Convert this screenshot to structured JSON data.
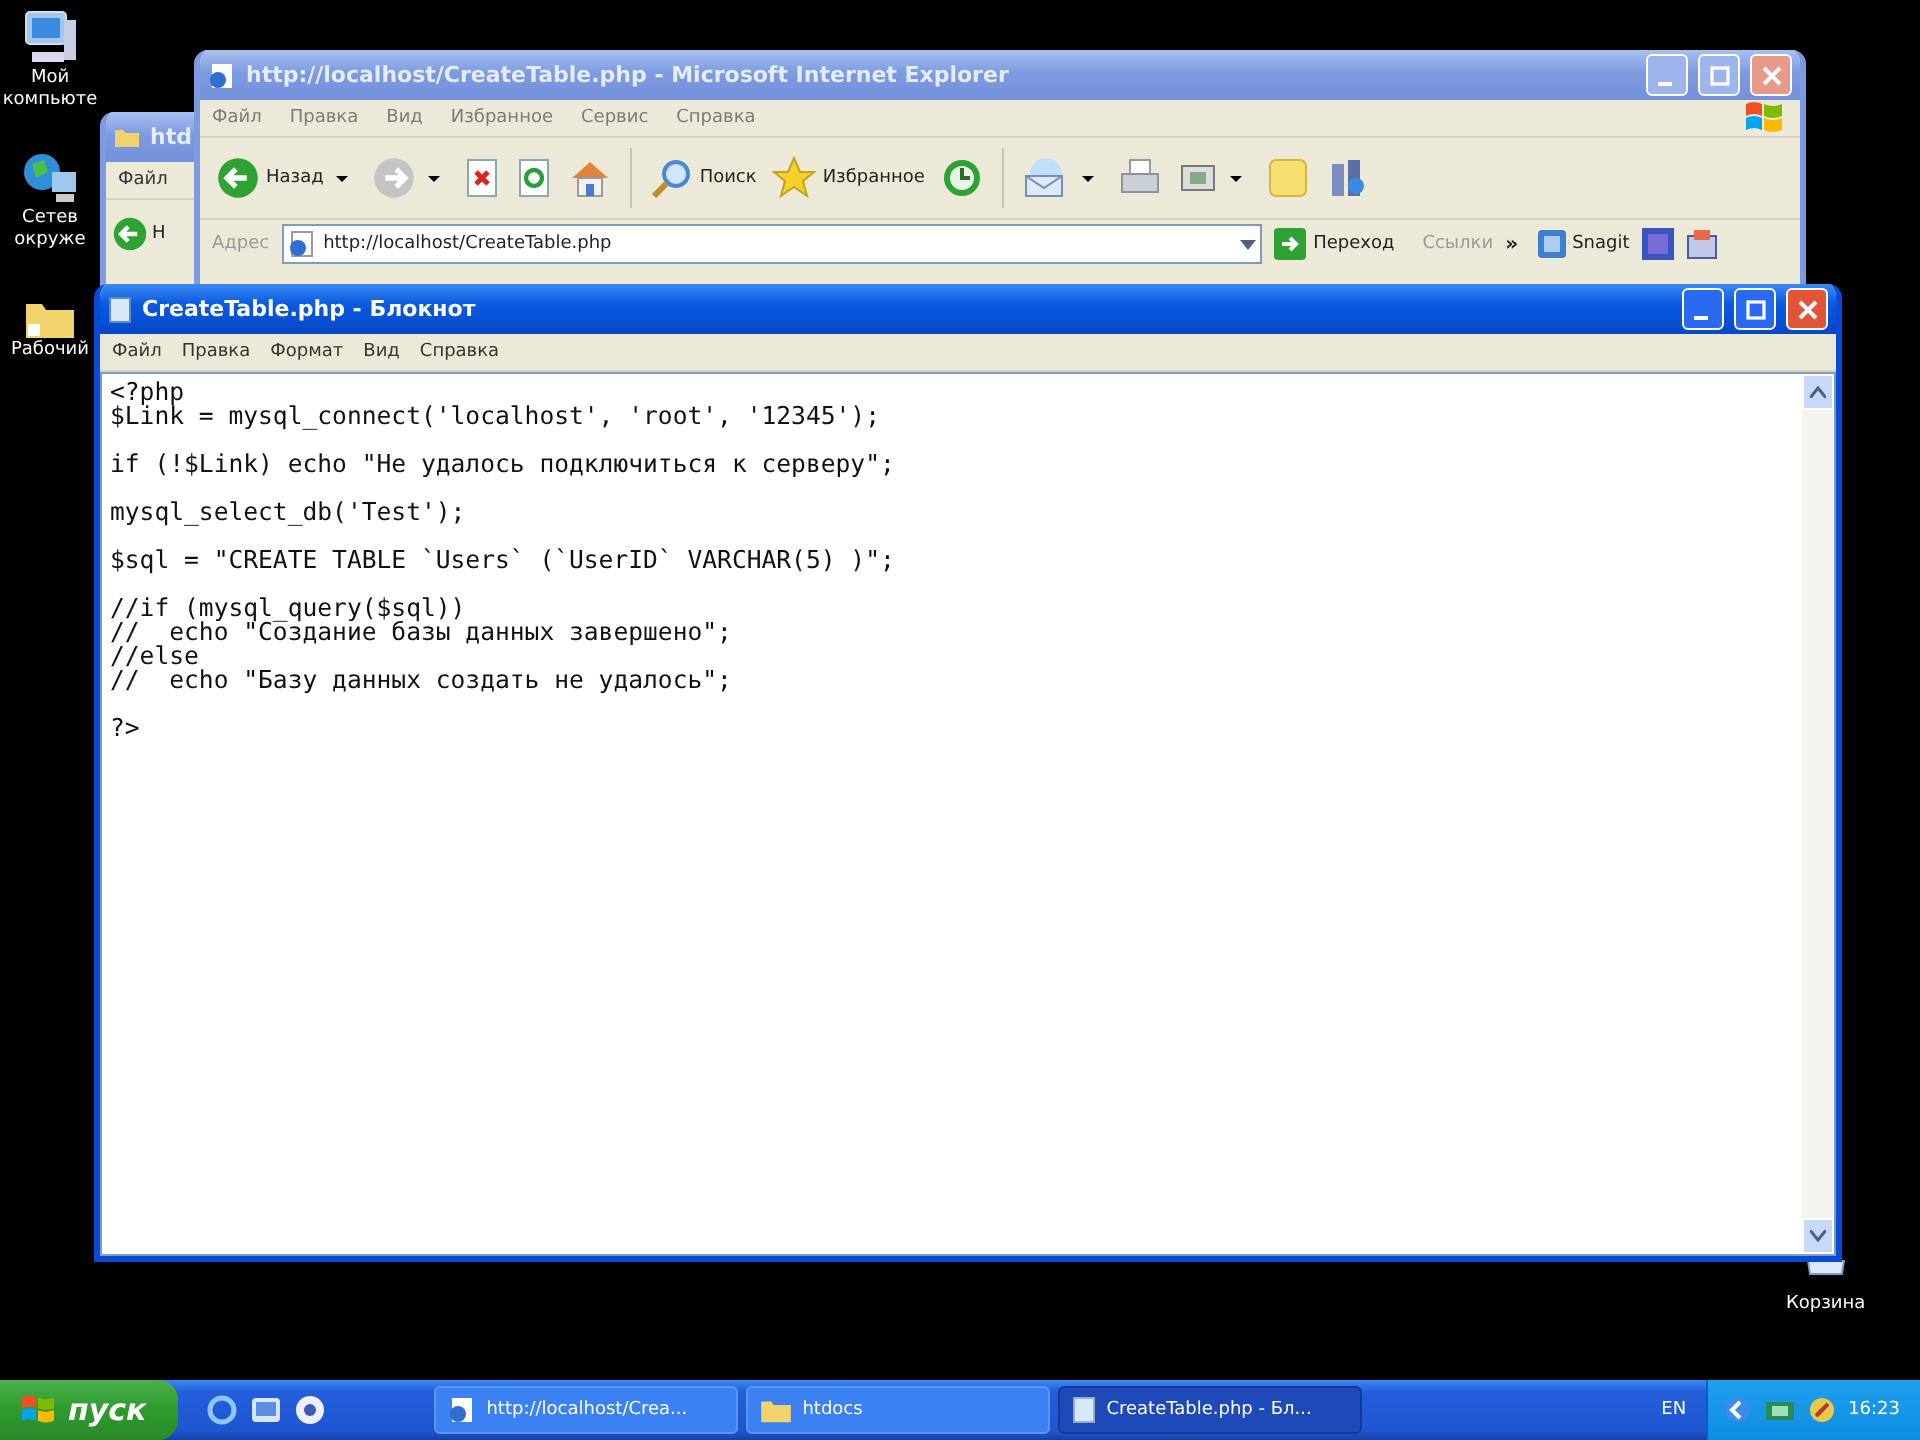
{
  "desktop_icons": [
    {
      "kind": "computer",
      "label": [
        "Мой",
        "компьюте"
      ]
    },
    {
      "kind": "network",
      "label": [
        "Сетев",
        "окруже"
      ]
    },
    {
      "kind": "folder",
      "label": [
        "Рабочий"
      ]
    }
  ],
  "recycle_bin": {
    "label": "Корзина"
  },
  "explorer_window": {
    "title": "htd",
    "active": false,
    "menu": [
      "Файл"
    ],
    "back_label": "Н"
  },
  "browser_window": {
    "title": "http://localhost/CreateTable.php - Microsoft Internet Explorer",
    "active": false,
    "menu": [
      "Файл",
      "Правка",
      "Вид",
      "Избранное",
      "Сервис",
      "Справка"
    ],
    "toolbar": [
      {
        "kind": "back",
        "label": "Назад",
        "dropdown": true
      },
      {
        "kind": "forward",
        "dropdown": true
      },
      {
        "kind": "stop"
      },
      {
        "kind": "refresh"
      },
      {
        "kind": "home"
      },
      {
        "kind": "search",
        "label": "Поиск"
      },
      {
        "kind": "favorites",
        "label": "Избранное"
      },
      {
        "kind": "history"
      },
      {
        "kind": "mail",
        "dropdown": true
      },
      {
        "kind": "print"
      },
      {
        "kind": "edit",
        "dropdown": true
      },
      {
        "kind": "notes"
      },
      {
        "kind": "messenger"
      }
    ],
    "address_label": "Адрес",
    "address": "http://localhost/CreateTable.php",
    "go_label": "Переход",
    "links_label": "Ссылки",
    "links_more": "»",
    "snagit_label": "Snagit"
  },
  "notepad_window": {
    "title": "CreateTable.php - Блокнот",
    "active": true,
    "menu": [
      "Файл",
      "Правка",
      "Формат",
      "Вид",
      "Справка"
    ],
    "paragraphs": [
      [
        "<?php",
        "$Link = mysql_connect('localhost', 'root', '12345');"
      ],
      [
        "if (!$Link) echo \"Не удалось подключиться к серверу\";"
      ],
      [
        "mysql_select_db('Test');"
      ],
      [
        "$sql = \"CREATE TABLE `Users` (`UserID` VARCHAR(5) )\";"
      ],
      [
        "//if (mysql_query($sql))",
        "//  echo \"Создание базы данных завершено\";",
        "//else",
        "//  echo \"Базу данных создать не удалось\";"
      ],
      [
        "?>"
      ]
    ]
  },
  "taskbar": {
    "start_label": "пуск",
    "tasks": [
      {
        "kind": "browser",
        "label": "http://localhost/Crea...",
        "selected": false
      },
      {
        "kind": "folder",
        "label": "htdocs",
        "selected": false
      },
      {
        "kind": "notepad",
        "label": "CreateTable.php - Бл...",
        "selected": true
      }
    ],
    "language": "EN",
    "clock": "16:23"
  }
}
